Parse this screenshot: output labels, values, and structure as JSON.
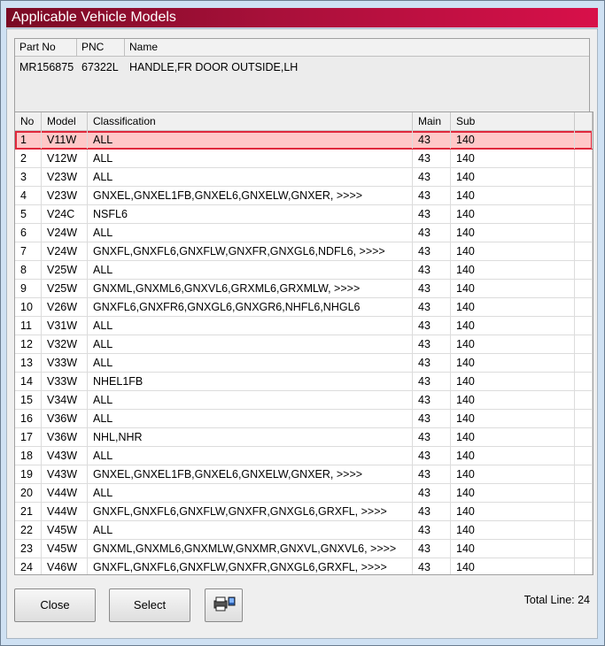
{
  "window": {
    "title": "Applicable Vehicle Models"
  },
  "part": {
    "headers": [
      "Part No",
      "PNC",
      "Name"
    ],
    "part_no": "MR156875",
    "pnc": "67322L",
    "name": "HANDLE,FR DOOR OUTSIDE,LH"
  },
  "table": {
    "headers": [
      "No",
      "Model",
      "Classification",
      "Main",
      "Sub"
    ],
    "rows": [
      {
        "no": "1",
        "model": "V11W",
        "classification": "ALL",
        "main": "43",
        "sub": "140"
      },
      {
        "no": "2",
        "model": "V12W",
        "classification": "ALL",
        "main": "43",
        "sub": "140"
      },
      {
        "no": "3",
        "model": "V23W",
        "classification": "ALL",
        "main": "43",
        "sub": "140"
      },
      {
        "no": "4",
        "model": "V23W",
        "classification": "GNXEL,GNXEL1FB,GNXEL6,GNXELW,GNXER,  >>>>",
        "main": "43",
        "sub": "140"
      },
      {
        "no": "5",
        "model": "V24C",
        "classification": "NSFL6",
        "main": "43",
        "sub": "140"
      },
      {
        "no": "6",
        "model": "V24W",
        "classification": "ALL",
        "main": "43",
        "sub": "140"
      },
      {
        "no": "7",
        "model": "V24W",
        "classification": "GNXFL,GNXFL6,GNXFLW,GNXFR,GNXGL6,NDFL6,  >>>>",
        "main": "43",
        "sub": "140"
      },
      {
        "no": "8",
        "model": "V25W",
        "classification": "ALL",
        "main": "43",
        "sub": "140"
      },
      {
        "no": "9",
        "model": "V25W",
        "classification": "GNXML,GNXML6,GNXVL6,GRXML6,GRXMLW,  >>>>",
        "main": "43",
        "sub": "140"
      },
      {
        "no": "10",
        "model": "V26W",
        "classification": "GNXFL6,GNXFR6,GNXGL6,GNXGR6,NHFL6,NHGL6",
        "main": "43",
        "sub": "140"
      },
      {
        "no": "11",
        "model": "V31W",
        "classification": "ALL",
        "main": "43",
        "sub": "140"
      },
      {
        "no": "12",
        "model": "V32W",
        "classification": "ALL",
        "main": "43",
        "sub": "140"
      },
      {
        "no": "13",
        "model": "V33W",
        "classification": "ALL",
        "main": "43",
        "sub": "140"
      },
      {
        "no": "14",
        "model": "V33W",
        "classification": "NHEL1FB",
        "main": "43",
        "sub": "140"
      },
      {
        "no": "15",
        "model": "V34W",
        "classification": "ALL",
        "main": "43",
        "sub": "140"
      },
      {
        "no": "16",
        "model": "V36W",
        "classification": "ALL",
        "main": "43",
        "sub": "140"
      },
      {
        "no": "17",
        "model": "V36W",
        "classification": "NHL,NHR",
        "main": "43",
        "sub": "140"
      },
      {
        "no": "18",
        "model": "V43W",
        "classification": "ALL",
        "main": "43",
        "sub": "140"
      },
      {
        "no": "19",
        "model": "V43W",
        "classification": "GNXEL,GNXEL1FB,GNXEL6,GNXELW,GNXER,  >>>>",
        "main": "43",
        "sub": "140"
      },
      {
        "no": "20",
        "model": "V44W",
        "classification": "ALL",
        "main": "43",
        "sub": "140"
      },
      {
        "no": "21",
        "model": "V44W",
        "classification": "GNXFL,GNXFL6,GNXFLW,GNXFR,GNXGL6,GRXFL,  >>>>",
        "main": "43",
        "sub": "140"
      },
      {
        "no": "22",
        "model": "V45W",
        "classification": "ALL",
        "main": "43",
        "sub": "140"
      },
      {
        "no": "23",
        "model": "V45W",
        "classification": "GNXML,GNXML6,GNXMLW,GNXMR,GNXVL,GNXVL6,  >>>>",
        "main": "43",
        "sub": "140"
      },
      {
        "no": "24",
        "model": "V46W",
        "classification": "GNXFL,GNXFL6,GNXFLW,GNXFR,GNXGL6,GRXFL,  >>>>",
        "main": "43",
        "sub": "140"
      }
    ],
    "selected_index": 0
  },
  "buttons": {
    "close": "Close",
    "select": "Select",
    "print_icon": "printer-icon"
  },
  "footer": {
    "total_line": "Total Line: 24"
  },
  "colors": {
    "title_start": "#7a0a24",
    "title_end": "#d8104a",
    "selection": "#ffc8c8",
    "selection_border": "#e0283c"
  }
}
